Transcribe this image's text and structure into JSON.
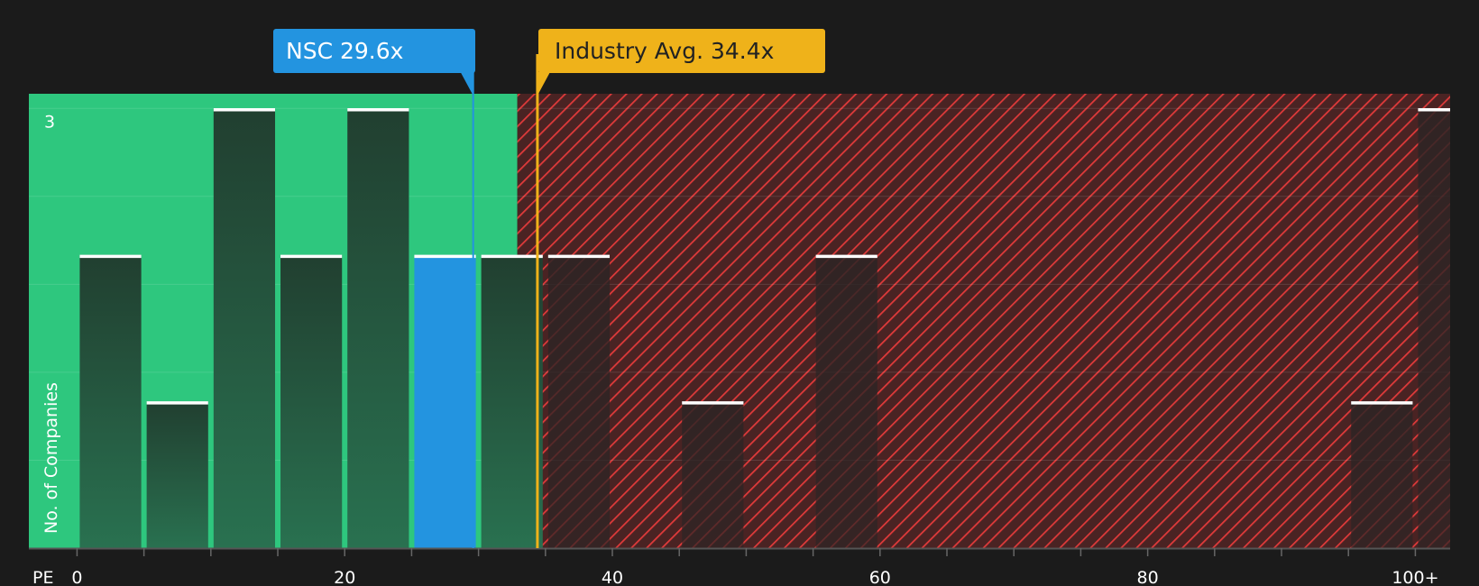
{
  "chart_data": {
    "type": "bar",
    "title": "",
    "xlabel": "PE",
    "ylabel": "No. of Companies",
    "ylim": [
      0,
      3.1
    ],
    "y_tick_labels": [
      {
        "value": 3,
        "label": "3"
      }
    ],
    "xlim": [
      -3.6,
      102.6
    ],
    "x_ticks": [
      0,
      5,
      10,
      15,
      20,
      25,
      30,
      35,
      40,
      45,
      50,
      55,
      60,
      65,
      70,
      75,
      80,
      85,
      90,
      95,
      100
    ],
    "x_tick_labels": [
      {
        "value": 0,
        "label": "0"
      },
      {
        "value": 20,
        "label": "20"
      },
      {
        "value": 40,
        "label": "40"
      },
      {
        "value": 60,
        "label": "60"
      },
      {
        "value": 80,
        "label": "80"
      },
      {
        "value": 100,
        "label": "100+"
      }
    ],
    "bin_width": 5,
    "bins": [
      {
        "start": 0,
        "value": 2
      },
      {
        "start": 5,
        "value": 1
      },
      {
        "start": 10,
        "value": 3
      },
      {
        "start": 15,
        "value": 2
      },
      {
        "start": 20,
        "value": 3
      },
      {
        "start": 25,
        "value": 2,
        "highlight": true
      },
      {
        "start": 30,
        "value": 2
      },
      {
        "start": 35,
        "value": 2
      },
      {
        "start": 45,
        "value": 1
      },
      {
        "start": 55,
        "value": 2
      },
      {
        "start": 95,
        "value": 1
      },
      {
        "start": 100,
        "value": 3
      }
    ],
    "green_zone_end": 32.9,
    "markers": [
      {
        "key": "company",
        "label": "NSC 29.6x",
        "value": 29.6,
        "color": "#2394e0",
        "text_color": "#ffffff"
      },
      {
        "key": "industry",
        "label": "Industry Avg. 34.4x",
        "value": 34.4,
        "color": "#efb21a",
        "text_color": "#222222"
      }
    ],
    "colors": {
      "background": "#1b1b1b",
      "green_zone": "#2ec77e",
      "red_zone": "#4a2323",
      "hatch": "#e03a3a",
      "bar": "#244a38",
      "bar_highlight": "#2394e0",
      "bar_top": "#ffffff"
    }
  }
}
